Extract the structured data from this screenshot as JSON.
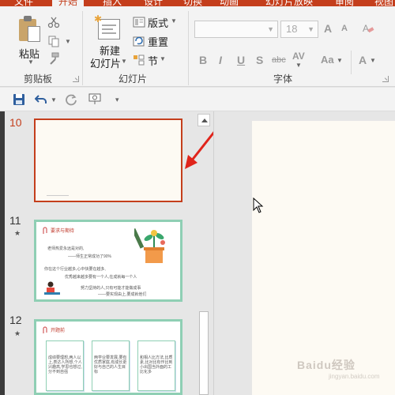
{
  "tabs": [
    {
      "label": "文件"
    },
    {
      "label": "开始"
    },
    {
      "label": "插入"
    },
    {
      "label": "设计"
    },
    {
      "label": "切换"
    },
    {
      "label": "动画"
    },
    {
      "label": "幻灯片放映"
    },
    {
      "label": "审阅"
    },
    {
      "label": "视图"
    }
  ],
  "ribbon": {
    "clipboard": {
      "paste_label": "粘贴",
      "group_label": "剪贴板"
    },
    "slides": {
      "new_slide_label_1": "新建",
      "new_slide_label_2": "幻灯片",
      "layout_label": "版式",
      "reset_label": "重置",
      "section_label": "节",
      "group_label": "幻灯片"
    },
    "font": {
      "font_name_value": "",
      "font_size_value": "18",
      "group_label": "字体",
      "bold": "B",
      "italic": "I",
      "underline": "U",
      "shadow": "S",
      "strike": "abc",
      "spacing": "AV",
      "case": "Aa",
      "grow": "A",
      "shrink": "A",
      "color_a": "A"
    }
  },
  "thumbnails": [
    {
      "number": "10",
      "star": ""
    },
    {
      "number": "11",
      "star": "★"
    },
    {
      "number": "12",
      "star": "★"
    }
  ],
  "slide11": {
    "title": "要求与期待",
    "line1": "老师热爱永远是对的,",
    "line2": "——师生正常成功了90%",
    "line3": "你在这个行业越多,心中快要在越多,",
    "line4": "优秀越来越多要有一个人,在成就每一个人",
    "line5": "努力坚持的人,只有可能才能做成事",
    "line6": "——要实现由上,要成就他们"
  },
  "slide12": {
    "title": "开题前",
    "card1": "成绩要理想,两人以上,表达人所想,个人兴趣高,学思也想过,分不到自强",
    "card2": "两学业要发展,要有优质家庭,有成长更好与自己的人生目标",
    "card3": "和相人比方法,比质素,比对比有作比到小出国当外面的工比化多"
  },
  "watermark": {
    "text": "Baidu经验",
    "sub": "jingyan.baidu.com"
  },
  "colors": {
    "accent": "#c43e1c",
    "thumb_border": "#8fcfb4",
    "arrow": "#e0241b"
  }
}
